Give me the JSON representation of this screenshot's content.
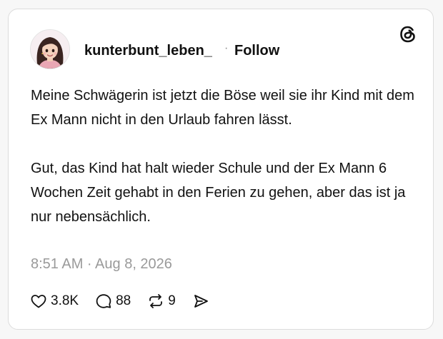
{
  "post": {
    "username": "kunterbunt_leben_",
    "separator": "·",
    "follow_label": "Follow",
    "paragraph_1": "Meine Schwägerin ist jetzt die Böse weil sie ihr Kind mit dem Ex Mann nicht in den Urlaub fahren lässt.",
    "paragraph_2": "Gut, das Kind hat halt wieder Schule und der Ex Mann 6 Wochen Zeit gehabt in den Ferien zu gehen, aber das ist ja nur nebensächlich.",
    "timestamp": "8:51 AM · Aug 8, 2026"
  },
  "actions": {
    "likes": "3.8K",
    "replies": "88",
    "reposts": "9"
  },
  "icons": {
    "brand": "threads-logo-icon",
    "like": "heart-icon",
    "reply": "comment-bubble-icon",
    "repost": "repost-icon",
    "share": "send-icon"
  },
  "colors": {
    "text": "#111111",
    "muted": "#9a9a9a",
    "card_border": "#dcdcdc"
  }
}
